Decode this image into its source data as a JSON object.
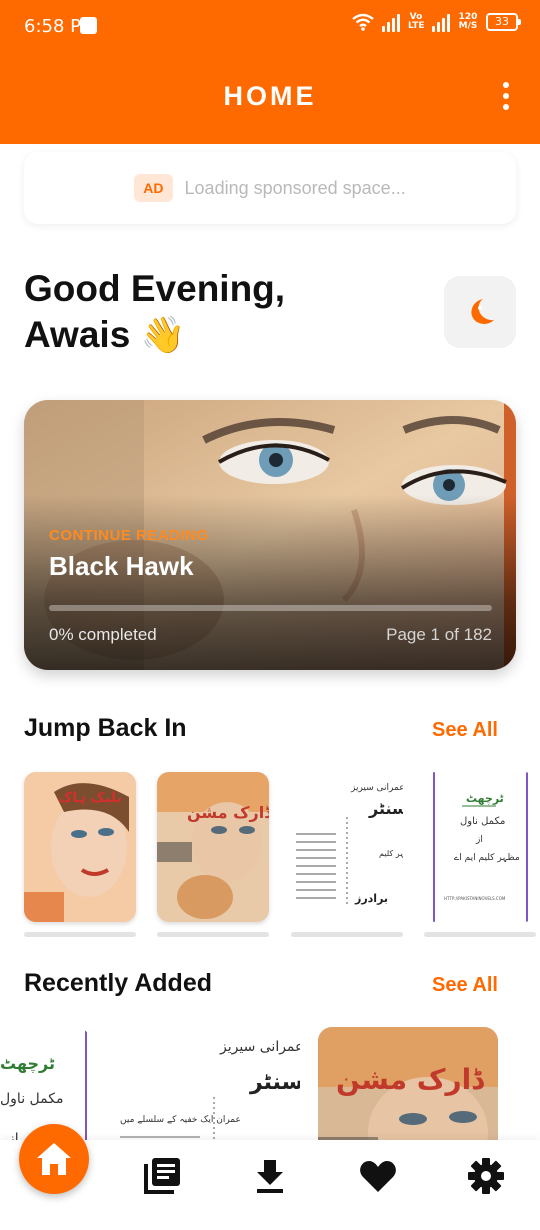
{
  "status_bar": {
    "time": "6:58 PM",
    "network": "Vo LTE",
    "speed_value": "120",
    "speed_unit": "M/S",
    "battery": "33"
  },
  "app_bar": {
    "title": "HOME",
    "menu_icon": "more-vert-icon"
  },
  "ad": {
    "badge": "AD",
    "text": "Loading sponsored space..."
  },
  "greeting": {
    "line1": "Good Evening,",
    "line2": "Awais",
    "emoji": "👋",
    "theme_icon": "moon-icon"
  },
  "continue_reading": {
    "label": "CONTINUE READING",
    "title": "Black Hawk",
    "progress_percent": 0,
    "progress_text": "0% completed",
    "page_text": "Page 1 of 182"
  },
  "jump_back_in": {
    "title": "Jump Back In",
    "see_all": "See All",
    "books": [
      {
        "cover_text": "بلیک ہاک",
        "cover_color": "#E86A2A"
      },
      {
        "cover_text": "ڈارک مشن",
        "cover_color": "#E9A15A"
      },
      {
        "cover_text": "ٹاسنٹر",
        "cover_color": "#FFFFFF"
      },
      {
        "cover_text": "مکمل ناول",
        "cover_color": "#FFFFFF"
      }
    ]
  },
  "recently_added": {
    "title": "Recently Added",
    "see_all": "See All",
    "books": [
      {
        "cover_text": "مکمل ناول"
      },
      {
        "cover_text": "ٹاسنٹر"
      },
      {
        "cover_text": "ڈارک مشن"
      }
    ]
  },
  "bottom_nav": {
    "items": [
      "home-icon",
      "library-icon",
      "download-icon",
      "favorites-icon",
      "settings-icon"
    ],
    "active_color": "#FF6A00"
  },
  "colors": {
    "accent": "#FF6A00",
    "text": "#111111",
    "muted": "#B9B9B9"
  }
}
